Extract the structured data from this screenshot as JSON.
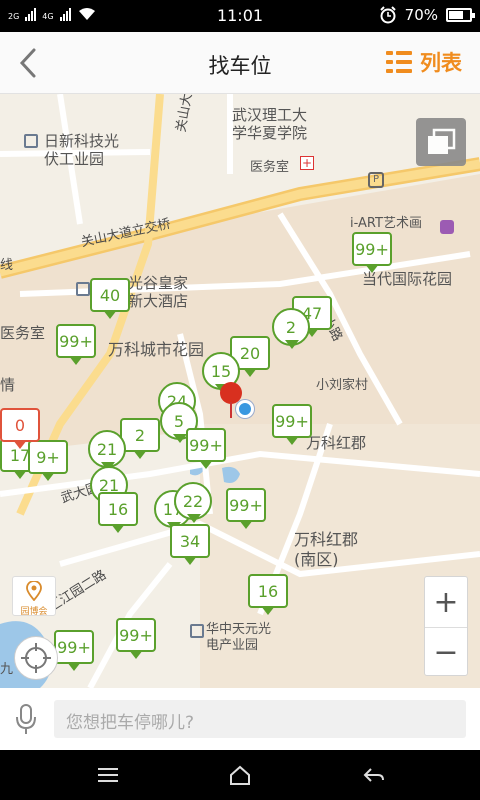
{
  "status_bar": {
    "signal1": "2G",
    "signal2": "4G",
    "time": "11:01",
    "battery": "70%",
    "battery_level": 0.7
  },
  "header": {
    "title": "找车位",
    "list_label": "列表"
  },
  "map": {
    "labels": {
      "wuhan_ligong": "武汉理工大",
      "wuhan_ligong2": "学华夏学院",
      "clinic": "医务室",
      "rixin": "日新科技光",
      "rixin2": "伏工业园",
      "guanshan_road": "关山大道",
      "guanshan_bridge": "关山大道立交桥",
      "iart": "i-ART艺术画",
      "dangdai": "当代国际花园",
      "guanggu": "光谷皇家",
      "xindajiudian": "新大酒店",
      "wanke_city": "万科城市花园",
      "xiaoliu": "小刘家村",
      "wanke_hongjun": "万科红郡",
      "wanke_hongjun2": "万科红郡",
      "nanqu": "(南区)",
      "huazhong": "华中天元光",
      "huazhong2": "电产业园",
      "clinic2": "医务室",
      "qing": "情",
      "line": "线",
      "wuda": "武大园",
      "jiangyuan": "汇江园二路",
      "small_road": "小路",
      "poi_label": "园博会",
      "jiu": "九"
    },
    "markers": [
      "40",
      "99+",
      "47",
      "2",
      "20",
      "15",
      "24",
      "5",
      "99+",
      "99+",
      "2",
      "21",
      "17",
      "9+",
      "0",
      "21",
      "16",
      "17",
      "22",
      "99+",
      "34",
      "99+",
      "16",
      "99+",
      "99+"
    ],
    "zoom_in": "+",
    "zoom_out": "−"
  },
  "search": {
    "placeholder": "您想把车停哪儿?"
  }
}
